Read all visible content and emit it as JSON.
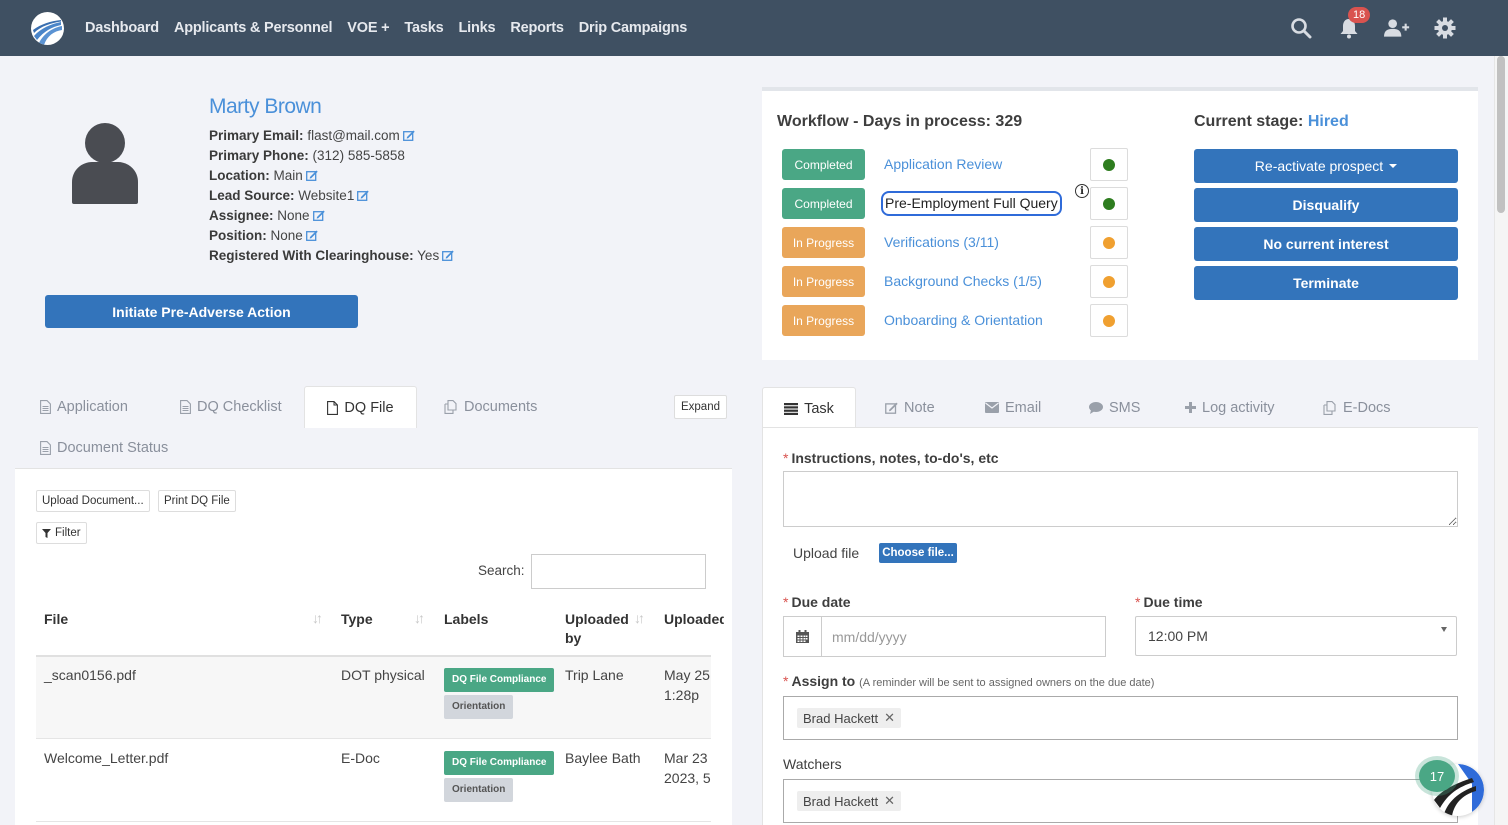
{
  "nav": {
    "links": [
      "Dashboard",
      "Applicants & Personnel",
      "VOE +",
      "Tasks",
      "Links",
      "Reports",
      "Drip Campaigns"
    ],
    "notifications_count": "18",
    "icons": [
      "search-icon",
      "bell-icon",
      "add-user-icon",
      "gear-icon"
    ]
  },
  "profile": {
    "name": "Marty Brown",
    "fields": [
      {
        "label": "Primary Email:",
        "value": "flast@mail.com",
        "editable": true
      },
      {
        "label": "Primary Phone:",
        "value": "(312) 585-5858",
        "editable": false
      },
      {
        "label": "Location:",
        "value": "Main",
        "editable": true
      },
      {
        "label": "Lead Source:",
        "value": "Website1",
        "editable": true
      },
      {
        "label": "Assignee:",
        "value": "None",
        "editable": true
      },
      {
        "label": "Position:",
        "value": "None",
        "editable": true
      },
      {
        "label": "Registered With Clearinghouse:",
        "value": "Yes",
        "editable": true
      }
    ],
    "pre_adverse_button": "Initiate Pre-Adverse Action"
  },
  "workflow": {
    "title": "Workflow - Days in process: 329",
    "steps": [
      {
        "status": "Completed",
        "name": "Application Review",
        "dot_color": "#2e7d1f"
      },
      {
        "status": "Completed",
        "name": "Pre-Employment Full Query",
        "dot_color": "#2e7d1f"
      },
      {
        "status": "In Progress",
        "name": "Verifications (3/11)",
        "dot_color": "#f0a030"
      },
      {
        "status": "In Progress",
        "name": "Background Checks (1/5)",
        "dot_color": "#f0a030"
      },
      {
        "status": "In Progress",
        "name": "Onboarding & Orientation",
        "dot_color": "#f0a030"
      }
    ],
    "info_glyph": "i",
    "stage_label": "Current stage:",
    "stage_value": "Hired",
    "actions": [
      "Re-activate prospect",
      "Disqualify",
      "No current interest",
      "Terminate"
    ]
  },
  "left_tabs": {
    "tabs": [
      "Application",
      "DQ Checklist",
      "DQ File",
      "Documents",
      "Document Status"
    ],
    "active": "DQ File",
    "expand": "Expand"
  },
  "dq_file": {
    "upload_button": "Upload Document...",
    "print_button": "Print DQ File",
    "filter_button": "Filter",
    "search_label": "Search:",
    "search_value": "",
    "columns": [
      "File",
      "Type",
      "Labels",
      "Uploaded by",
      "Uploaded at"
    ],
    "rows": [
      {
        "file": "_scan0156.pdf",
        "type": "DOT physical",
        "labels": [
          "DQ File Compliance",
          "Orientation"
        ],
        "uploaded_by": "Trip Lane",
        "uploaded_at_1": "May 25",
        "uploaded_at_2": "1:28p"
      },
      {
        "file": "Welcome_Letter.pdf",
        "type": "E-Doc",
        "labels": [
          "DQ File Compliance",
          "Orientation"
        ],
        "uploaded_by": "Baylee Bath",
        "uploaded_at_1": "Mar 23",
        "uploaded_at_2": "2023, 5"
      }
    ]
  },
  "right_tabs": {
    "tabs": [
      "Task",
      "Note",
      "Email",
      "SMS",
      "Log activity",
      "E-Docs"
    ],
    "active": "Task"
  },
  "task_form": {
    "instructions_label": "Instructions, notes, to-do's, etc",
    "instructions_value": "",
    "upload_label": "Upload file",
    "choose_file": "Choose file...",
    "due_date_label": "Due date",
    "due_date_placeholder": "mm/dd/yyyy",
    "due_time_label": "Due time",
    "due_time_value": "12:00 PM",
    "assign_label": "Assign to",
    "assign_hint": "(A reminder will be sent to assigned owners on the due date)",
    "assignees": [
      "Brad Hackett"
    ],
    "watchers_label": "Watchers",
    "watchers": [
      "Brad Hackett"
    ]
  },
  "widget": {
    "count": "17"
  }
}
